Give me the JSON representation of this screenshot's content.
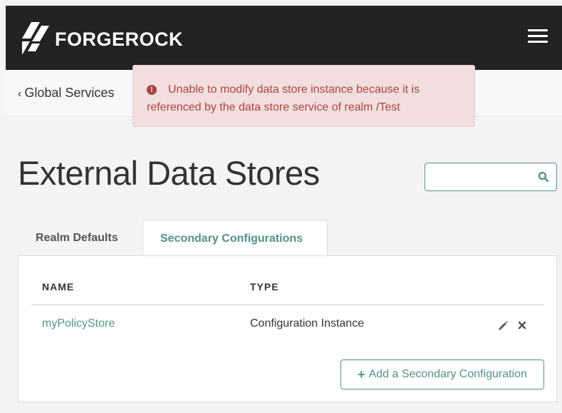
{
  "header": {
    "brand": "FORGEROCK",
    "menu_icon": "hamburger-menu-icon"
  },
  "nav": {
    "back_chevron": "‹",
    "back_label": "Global Services"
  },
  "alert": {
    "icon": "exclamation-circle-icon",
    "icon_glyph": "!",
    "message": "Unable to modify data store instance because it is referenced by the data store service of realm /Test",
    "color": "#a94442",
    "background": "#f2dede"
  },
  "page": {
    "title": "External Data Stores"
  },
  "search": {
    "value": "",
    "placeholder": "",
    "icon": "search-icon"
  },
  "tabs": [
    {
      "label": "Realm Defaults",
      "active": false
    },
    {
      "label": "Secondary Configurations",
      "active": true
    }
  ],
  "table": {
    "columns": [
      "NAME",
      "TYPE"
    ],
    "rows": [
      {
        "name": "myPolicyStore",
        "type": "Configuration Instance",
        "actions": [
          "pencil-icon",
          "close-icon"
        ]
      }
    ]
  },
  "add_button": {
    "plus": "+",
    "label": "Add a Secondary Configuration"
  },
  "colors": {
    "accent": "#519387",
    "topbar": "#222222"
  }
}
